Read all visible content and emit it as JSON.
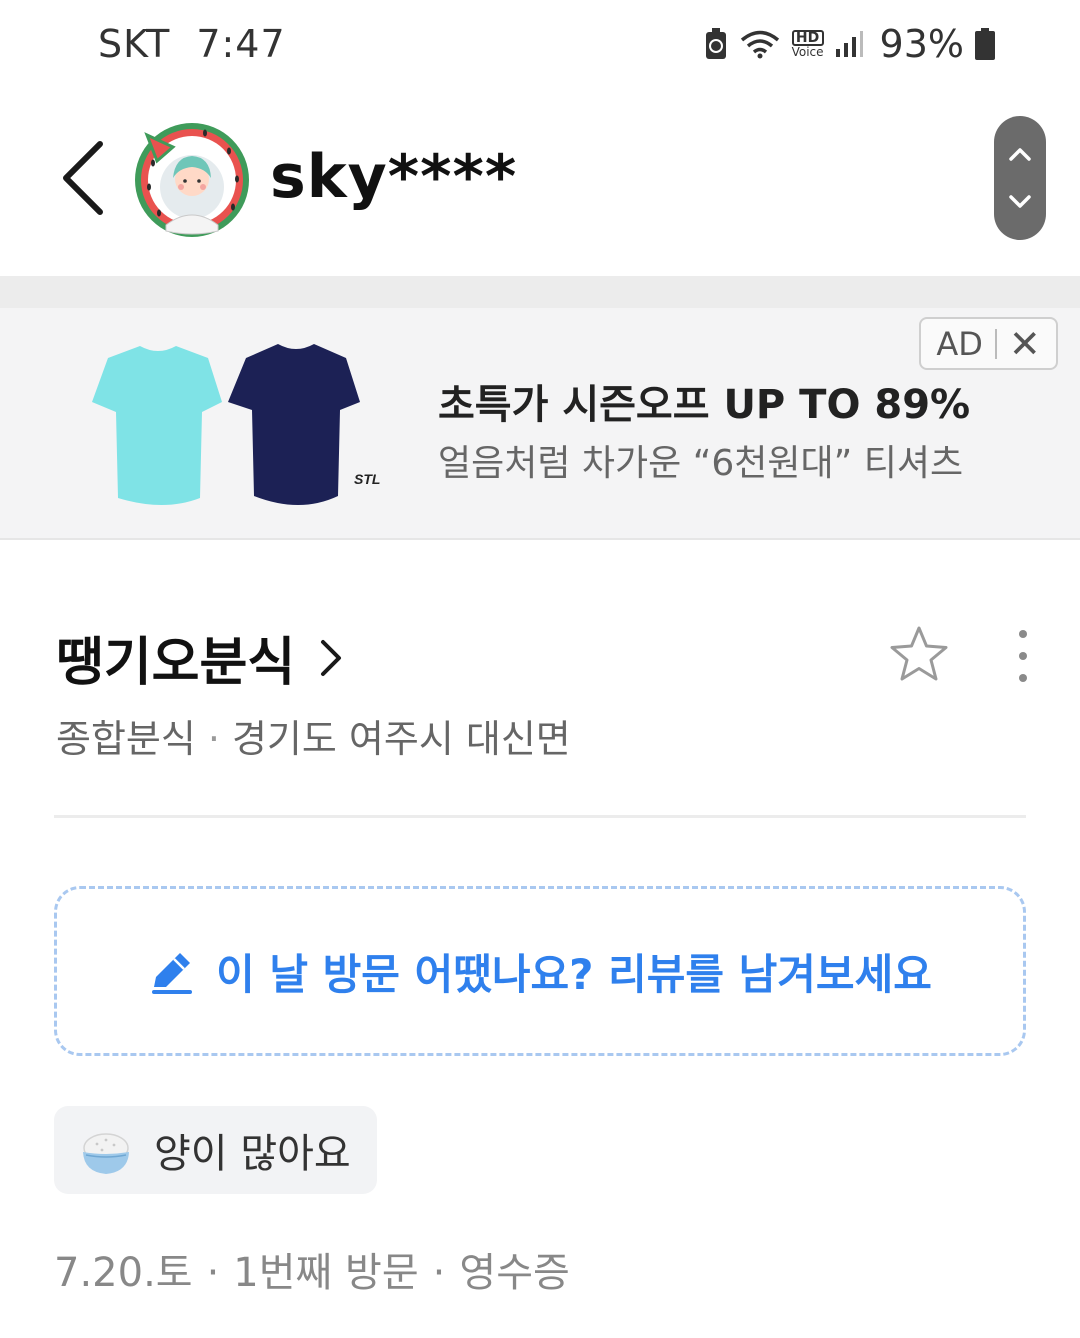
{
  "status_bar": {
    "carrier": "SKT",
    "time": "7:47",
    "hd_voice_top": "HD",
    "hd_voice_bottom": "Voice",
    "battery_percent": "93%",
    "icons": [
      "battery-saver-icon",
      "wifi-icon",
      "signal-icon",
      "battery-icon"
    ]
  },
  "header": {
    "username": "sky****",
    "back_icon": "chevron-left-icon",
    "avatar": "watermelon-frame-avatar",
    "nav_icons": [
      "chevron-up-icon",
      "chevron-down-icon"
    ]
  },
  "ad": {
    "badge_label": "AD",
    "close_label": "✕",
    "title": "초특가 시즌오프 UP TO 89%",
    "subtitle": "얼음처럼 차가운 “6천원대” 티셔츠",
    "brand_mark": "STL",
    "colors": {
      "mint_shirt": "#7fe3e6",
      "navy_shirt": "#1c2155"
    }
  },
  "store": {
    "name": "땡기오분식",
    "category": "종합분식",
    "separator": "·",
    "location": "경기도 여주시 대신면"
  },
  "review_prompt": {
    "text": "이 날 방문 어땠나요? 리뷰를 남겨보세요",
    "icon": "pencil-icon",
    "accent_color": "#2f80ed"
  },
  "keyword_chip": {
    "label": "양이 많아요",
    "icon": "rice-bowl-icon"
  },
  "visit_meta": {
    "date": "7.20.토",
    "separator": "·",
    "visit_count": "1번째 방문",
    "verification": "영수증"
  }
}
